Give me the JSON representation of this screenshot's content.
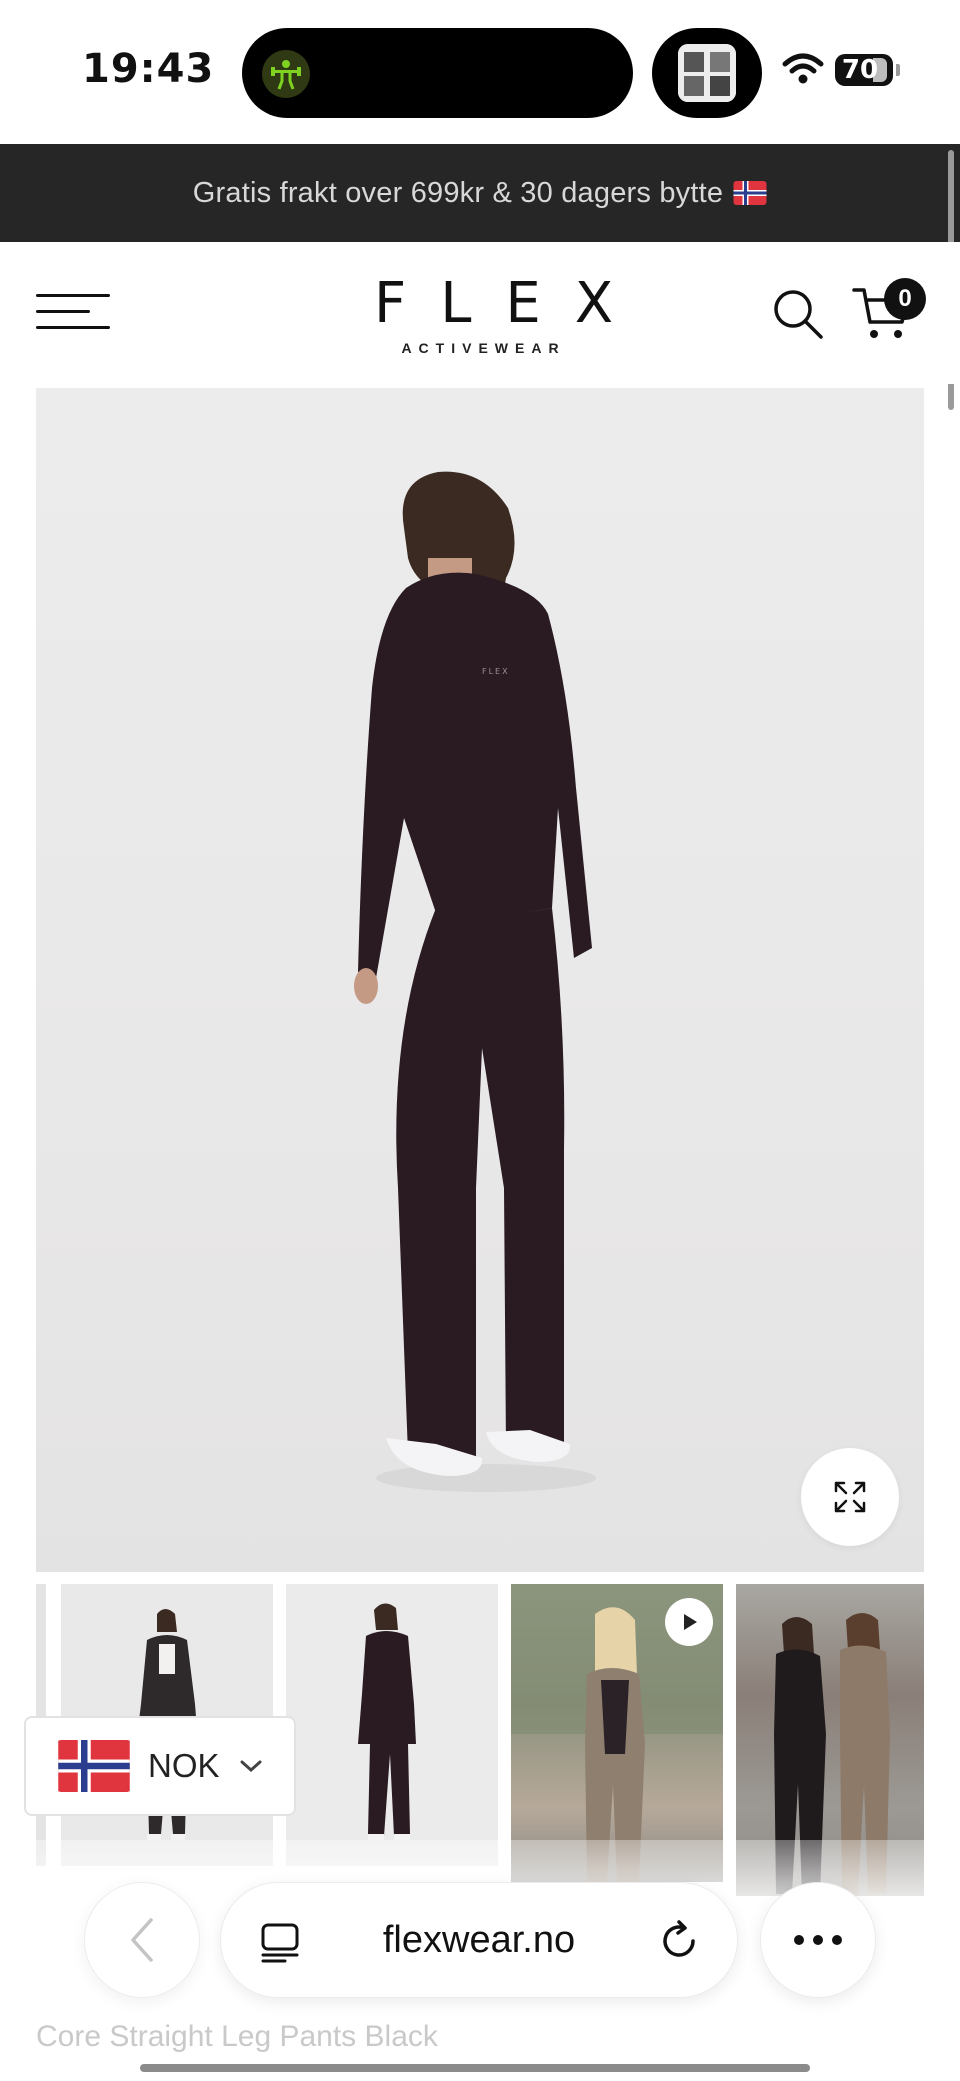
{
  "status_bar": {
    "time": "19:43",
    "battery": "70"
  },
  "announcement": {
    "text": "Gratis frakt over 699kr & 30 dagers bytte",
    "flag_icon": "norway-flag"
  },
  "header": {
    "logo": "FLEX",
    "logo_sub": "ACTIVEWEAR",
    "cart_count": "0"
  },
  "currency": {
    "code": "NOK",
    "flag_icon": "norway-flag"
  },
  "browser": {
    "url": "flexwear.no"
  },
  "product": {
    "title": "Core Straight Leg Pants Black"
  },
  "colors": {
    "announcement_bg": "#262626",
    "garment": "#2a1a22",
    "image_bg": "#ebebeb"
  }
}
